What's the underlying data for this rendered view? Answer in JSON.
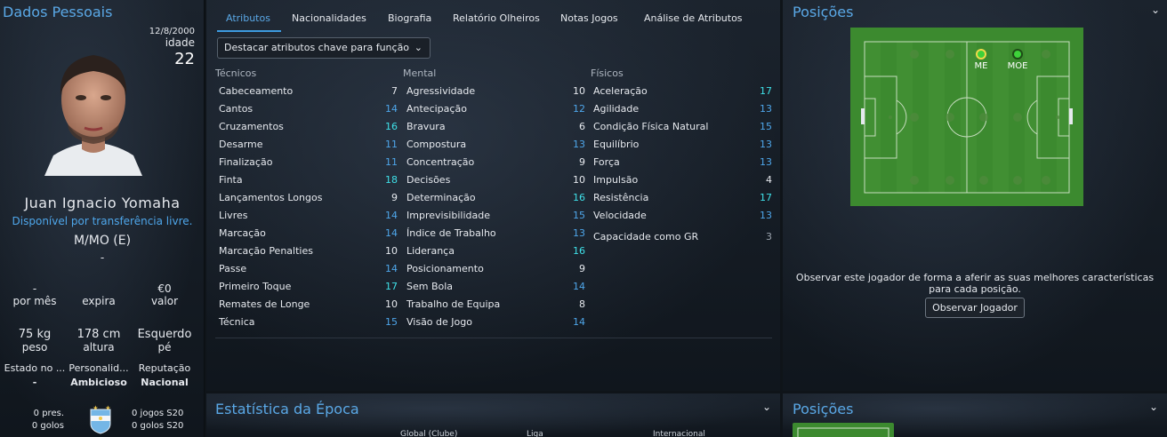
{
  "left": {
    "title": "Dados Pessoais",
    "dob": "12/8/2000",
    "age_label": "idade",
    "age": "22",
    "name": "Juan Ignacio Yomaha",
    "transfer": "Disponível por transferência livre.",
    "position": "M/MO (E)",
    "dash": "-",
    "wage_value": "-",
    "wage_label": "por mês",
    "expires_label": "expira",
    "value_value": "€0",
    "value_label": "valor",
    "weight_value": "75 kg",
    "weight_label": "peso",
    "height_value": "178 cm",
    "height_label": "altura",
    "foot_value": "Esquerdo",
    "foot_label": "pé",
    "status_label": "Estado no ...",
    "status_value": "-",
    "personality_label": "Personalid...",
    "personality_value": "Ambicioso",
    "reputation_label": "Reputação",
    "reputation_value": "Nacional",
    "caps": "0 pres.",
    "goals": "0 golos",
    "u20_games": "0 jogos S20",
    "u20_goals": "0 golos S20"
  },
  "tabs": [
    "Atributos",
    "Nacionalidades",
    "Biografia",
    "Relatório Olheiros",
    "Notas Jogos",
    "Análise de Atributos"
  ],
  "dropdown": {
    "label": "Destacar atributos chave para função",
    "icon": "chevron-down-icon"
  },
  "technical": {
    "header": "Técnicos",
    "items": [
      {
        "label": "Cabeceamento",
        "value": "7"
      },
      {
        "label": "Cantos",
        "value": "14"
      },
      {
        "label": "Cruzamentos",
        "value": "16"
      },
      {
        "label": "Desarme",
        "value": "11"
      },
      {
        "label": "Finalização",
        "value": "11"
      },
      {
        "label": "Finta",
        "value": "18"
      },
      {
        "label": "Lançamentos Longos",
        "value": "9"
      },
      {
        "label": "Livres",
        "value": "14"
      },
      {
        "label": "Marcação",
        "value": "14"
      },
      {
        "label": "Marcação Penalties",
        "value": "10"
      },
      {
        "label": "Passe",
        "value": "14"
      },
      {
        "label": "Primeiro Toque",
        "value": "17"
      },
      {
        "label": "Remates de Longe",
        "value": "10"
      },
      {
        "label": "Técnica",
        "value": "15"
      }
    ]
  },
  "mental": {
    "header": "Mental",
    "items": [
      {
        "label": "Agressividade",
        "value": "10"
      },
      {
        "label": "Antecipação",
        "value": "12"
      },
      {
        "label": "Bravura",
        "value": "6"
      },
      {
        "label": "Compostura",
        "value": "13"
      },
      {
        "label": "Concentração",
        "value": "9"
      },
      {
        "label": "Decisões",
        "value": "10"
      },
      {
        "label": "Determinação",
        "value": "16"
      },
      {
        "label": "Imprevisibilidade",
        "value": "15"
      },
      {
        "label": "Índice de Trabalho",
        "value": "13"
      },
      {
        "label": "Liderança",
        "value": "16"
      },
      {
        "label": "Posicionamento",
        "value": "9"
      },
      {
        "label": "Sem Bola",
        "value": "14"
      },
      {
        "label": "Trabalho de Equipa",
        "value": "8"
      },
      {
        "label": "Visão de Jogo",
        "value": "14"
      }
    ]
  },
  "physical": {
    "header": "Físicos",
    "items": [
      {
        "label": "Aceleração",
        "value": "17"
      },
      {
        "label": "Agilidade",
        "value": "13"
      },
      {
        "label": "Condição Física Natural",
        "value": "15"
      },
      {
        "label": "Equilíbrio",
        "value": "13"
      },
      {
        "label": "Força",
        "value": "13"
      },
      {
        "label": "Impulsão",
        "value": "4"
      },
      {
        "label": "Resistência",
        "value": "17"
      },
      {
        "label": "Velocidade",
        "value": "13"
      }
    ],
    "gk_label": "Capacidade como GR",
    "gk_value": "3"
  },
  "season": {
    "title": "Estatística da Época",
    "col1": "Global (Clube)",
    "col2": "Liga",
    "col3": "Internacional"
  },
  "positions": {
    "title": "Posições",
    "marker1": "ME",
    "marker2": "MOE",
    "observe_text_1": "Observar este jogador de forma a aferir as suas melhores características",
    "observe_text_2": "para cada posição.",
    "observe_button": "Observar Jogador"
  },
  "positions2": {
    "title": "Posições"
  },
  "colors": {
    "accent": "#5aa8e6",
    "value_white": "#e6e9ee",
    "value_blue": "#4ea6ea",
    "value_cyan": "#3fe0e8",
    "value_grey": "#9aa3ad",
    "pitch": "#3c8a2f"
  }
}
